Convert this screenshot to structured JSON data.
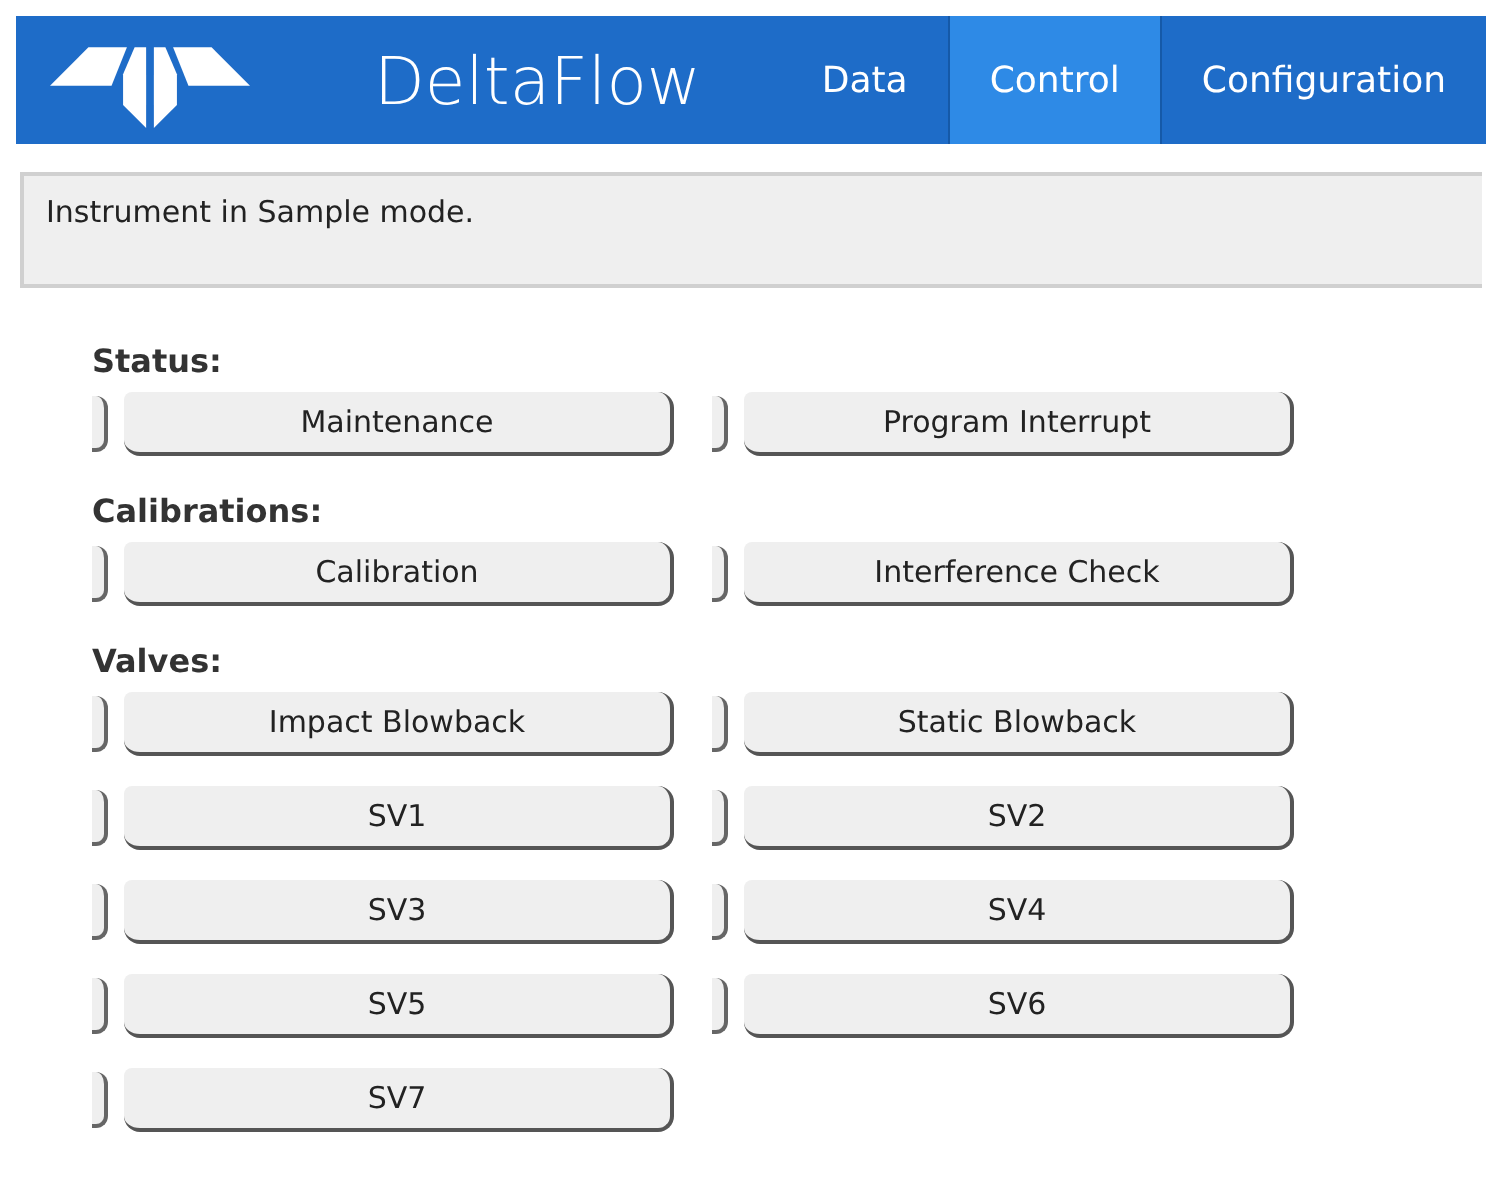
{
  "header": {
    "title": "DeltaFlow",
    "tabs": [
      {
        "label": "Data",
        "selected": false
      },
      {
        "label": "Control",
        "selected": true
      },
      {
        "label": "Configuration",
        "selected": false
      }
    ]
  },
  "message": "Instrument in Sample mode.",
  "sections": [
    {
      "label": "Status:",
      "buttons": [
        {
          "label": "Maintenance",
          "on": false
        },
        {
          "label": "Program Interrupt",
          "on": false
        }
      ]
    },
    {
      "label": "Calibrations:",
      "buttons": [
        {
          "label": "Calibration",
          "on": false
        },
        {
          "label": "Interference Check",
          "on": false
        }
      ]
    },
    {
      "label": "Valves:",
      "buttons": [
        {
          "label": "Impact Blowback",
          "on": false
        },
        {
          "label": "Static Blowback",
          "on": false
        },
        {
          "label": "SV1",
          "on": false
        },
        {
          "label": "SV2",
          "on": false
        },
        {
          "label": "SV3",
          "on": false
        },
        {
          "label": "SV4",
          "on": false
        },
        {
          "label": "SV5",
          "on": false
        },
        {
          "label": "SV6",
          "on": false
        },
        {
          "label": "SV7",
          "on": false
        }
      ]
    }
  ]
}
